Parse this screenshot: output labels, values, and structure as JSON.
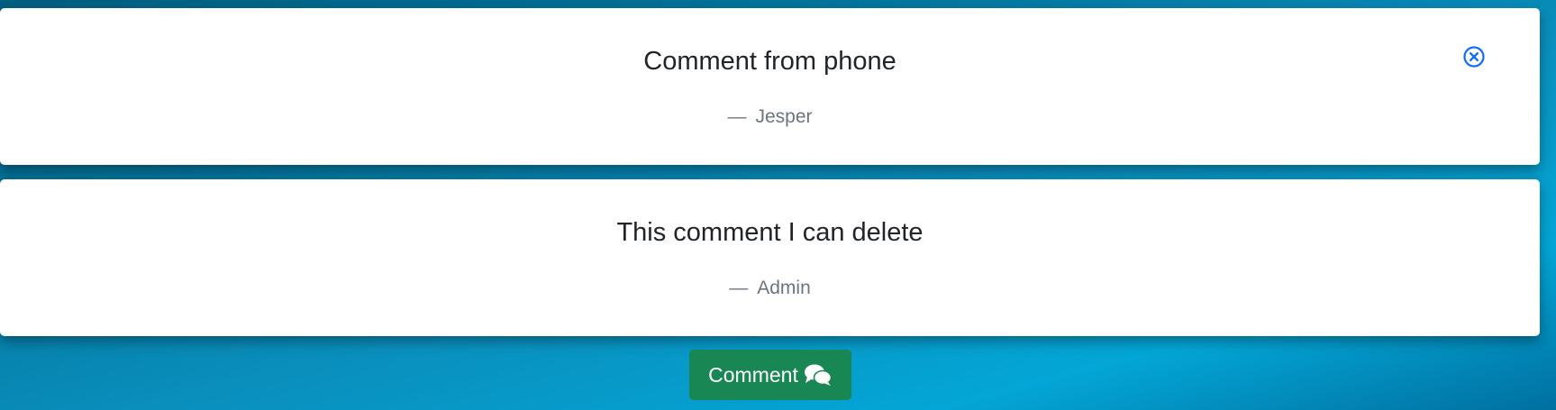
{
  "comments": [
    {
      "text": "Comment from phone",
      "author": "Jesper",
      "author_dash": "—",
      "delete_icon": "close-circle-icon"
    },
    {
      "text": "This comment I can delete",
      "author": "Admin",
      "author_dash": "—"
    }
  ],
  "comment_button": {
    "label": "Comment",
    "icon": "comments-icon"
  },
  "colors": {
    "card_background": "#ffffff",
    "comment_text": "#212529",
    "author_text": "#6c757d",
    "delete_icon": "#0d6efd",
    "button_background": "#198754",
    "button_text": "#ffffff"
  }
}
